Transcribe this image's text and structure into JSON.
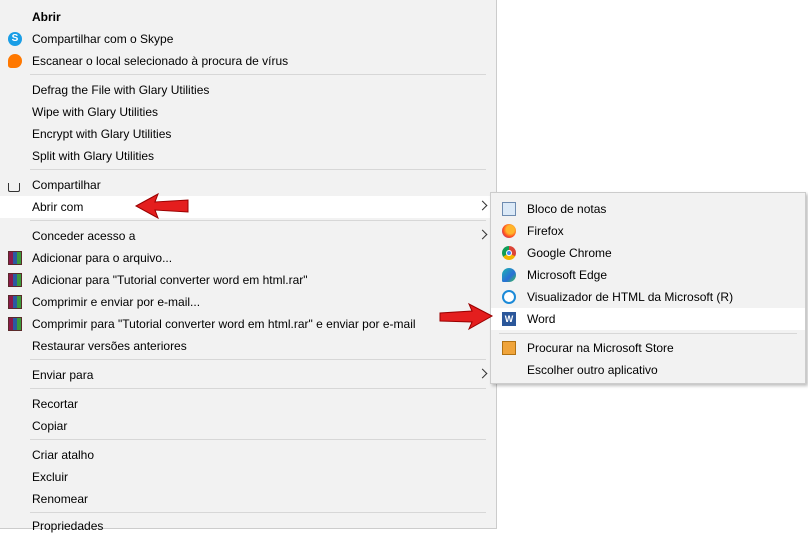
{
  "main_menu": {
    "items": [
      {
        "label": "Abrir",
        "icon": "",
        "bold": true
      },
      {
        "label": "Compartilhar com o Skype",
        "icon": "skype-icon"
      },
      {
        "label": "Escanear o local selecionado à procura de vírus",
        "icon": "avast-icon"
      },
      {
        "label": "Defrag the File with Glary Utilities",
        "icon": ""
      },
      {
        "label": "Wipe with Glary Utilities",
        "icon": ""
      },
      {
        "label": "Encrypt with Glary Utilities",
        "icon": ""
      },
      {
        "label": "Split with Glary Utilities",
        "icon": ""
      },
      {
        "label": "Compartilhar",
        "icon": "share-icon"
      },
      {
        "label": "Abrir com",
        "icon": "",
        "submenu": true,
        "highlighted": true
      },
      {
        "label": "Conceder acesso a",
        "icon": "",
        "submenu": true
      },
      {
        "label": "Adicionar para o arquivo...",
        "icon": "winrar-icon"
      },
      {
        "label": "Adicionar para \"Tutorial converter word em html.rar\"",
        "icon": "winrar-icon"
      },
      {
        "label": "Comprimir e enviar por e-mail...",
        "icon": "winrar-icon"
      },
      {
        "label": "Comprimir para \"Tutorial converter word em html.rar\" e enviar por e-mail",
        "icon": "winrar-icon"
      },
      {
        "label": "Restaurar versões anteriores",
        "icon": ""
      },
      {
        "label": "Enviar para",
        "icon": "",
        "submenu": true
      },
      {
        "label": "Recortar",
        "icon": ""
      },
      {
        "label": "Copiar",
        "icon": ""
      },
      {
        "label": "Criar atalho",
        "icon": ""
      },
      {
        "label": "Excluir",
        "icon": ""
      },
      {
        "label": "Renomear",
        "icon": ""
      },
      {
        "label": "Propriedades",
        "icon": ""
      }
    ]
  },
  "open_with_menu": {
    "items": [
      {
        "label": "Bloco de notas",
        "icon": "notepad-icon"
      },
      {
        "label": "Firefox",
        "icon": "firefox-icon"
      },
      {
        "label": "Google Chrome",
        "icon": "chrome-icon"
      },
      {
        "label": "Microsoft Edge",
        "icon": "edge-icon"
      },
      {
        "label": "Visualizador de HTML da Microsoft (R)",
        "icon": "ie-icon"
      },
      {
        "label": "Word",
        "icon": "word-icon",
        "highlighted": true
      },
      {
        "label": "Procurar na Microsoft Store",
        "icon": "store-icon"
      },
      {
        "label": "Escolher outro aplicativo",
        "icon": ""
      }
    ]
  },
  "icon_glyphs": {
    "skype": "S",
    "word": "W"
  },
  "colors": {
    "menu_bg": "#f2f2f2",
    "highlight": "#ffffff",
    "annotation_arrow": "#e41e1e"
  }
}
